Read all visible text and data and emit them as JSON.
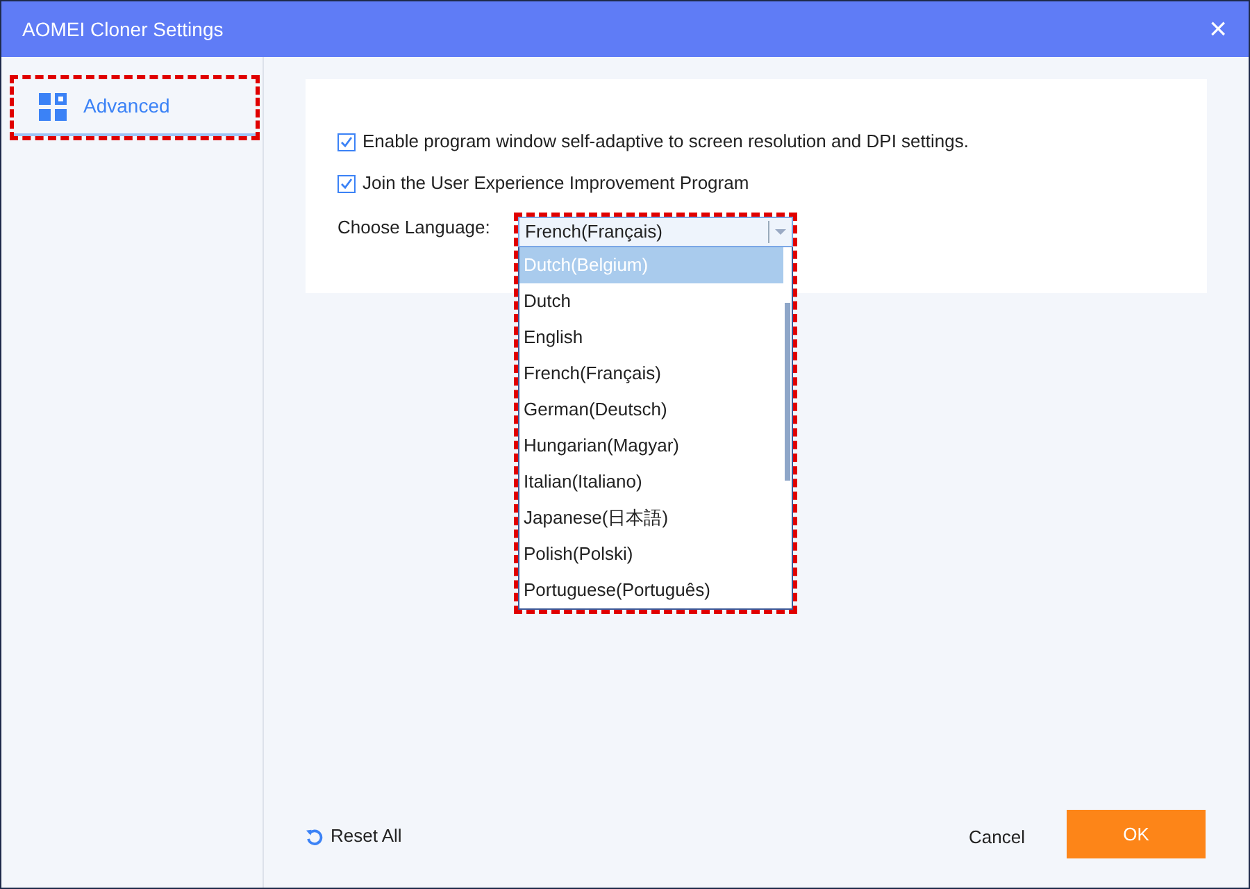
{
  "window": {
    "title": "AOMEI Cloner Settings",
    "close": "×"
  },
  "sidebar": {
    "items": [
      {
        "label": "Advanced",
        "selected": true,
        "highlighted": true
      }
    ]
  },
  "settings": {
    "options": [
      {
        "label": "Enable program window self-adaptive to screen resolution and DPI settings.",
        "checked": true
      },
      {
        "label": "Join the User Experience Improvement Program",
        "checked": true
      }
    ],
    "language": {
      "label": "Choose Language:",
      "value": "French(Français)",
      "expanded": true,
      "highlighted": true,
      "options": [
        {
          "label": "Dutch(Belgium)",
          "hovered": true
        },
        {
          "label": "Dutch",
          "hovered": false
        },
        {
          "label": "English",
          "hovered": false
        },
        {
          "label": "French(Français)",
          "hovered": false
        },
        {
          "label": "German(Deutsch)",
          "hovered": false
        },
        {
          "label": "Hungarian(Magyar)",
          "hovered": false
        },
        {
          "label": "Italian(Italiano)",
          "hovered": false
        },
        {
          "label": "Japanese(日本語)",
          "hovered": false
        },
        {
          "label": "Polish(Polski)",
          "hovered": false
        },
        {
          "label": "Portuguese(Português)",
          "hovered": false
        }
      ]
    }
  },
  "footer": {
    "reset": "Reset All",
    "cancel": "Cancel",
    "ok": "OK"
  }
}
